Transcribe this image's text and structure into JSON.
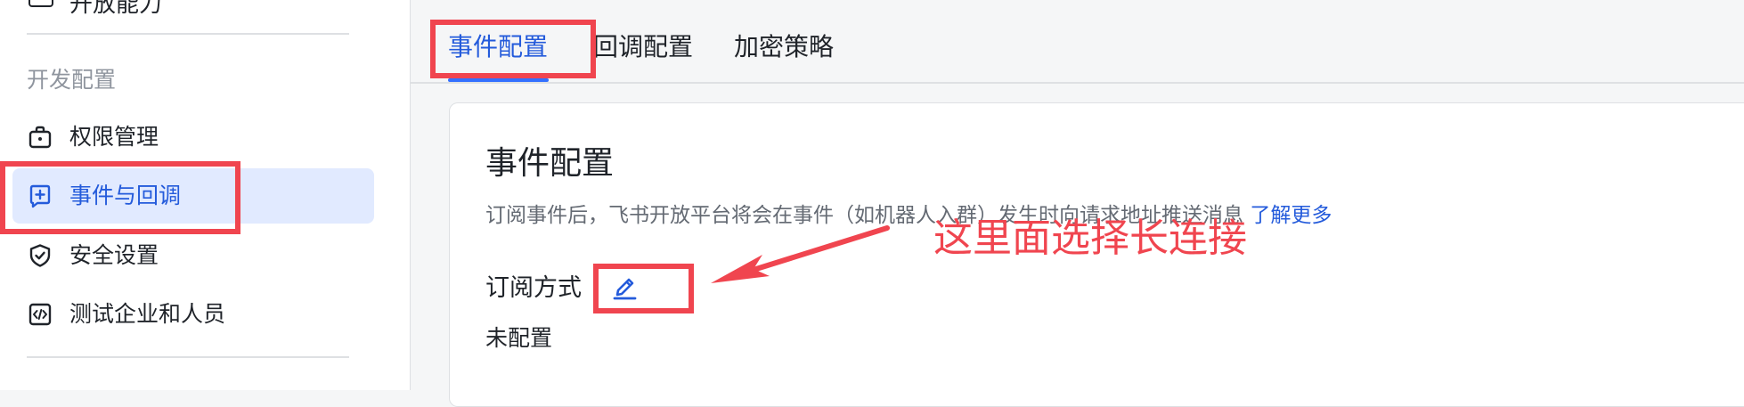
{
  "sidebar": {
    "cut_top_text": "开放能力",
    "section_title": "开发配置",
    "items": [
      {
        "label": "权限管理",
        "icon": "briefcase-icon",
        "active": false
      },
      {
        "label": "事件与回调",
        "icon": "event-plus-icon",
        "active": true
      },
      {
        "label": "安全设置",
        "icon": "shield-check-icon",
        "active": false
      },
      {
        "label": "测试企业和人员",
        "icon": "code-box-icon",
        "active": false
      }
    ]
  },
  "tabs": [
    {
      "label": "事件配置",
      "active": true
    },
    {
      "label": "回调配置",
      "active": false
    },
    {
      "label": "加密策略",
      "active": false
    }
  ],
  "card": {
    "title": "事件配置",
    "description": "订阅事件后，飞书开放平台将会在事件（如机器人入群）发生时向请求地址推送消息",
    "learn_more": "了解更多",
    "subscription_label": "订阅方式",
    "edit_icon": "pencil-icon",
    "status": "未配置"
  },
  "annotation": {
    "text": "这里面选择长连接",
    "color": "#f0454f"
  },
  "colors": {
    "accent": "#245bdb",
    "active_bg": "#e1eaff",
    "muted_text": "#8f959e",
    "annotation": "#f0454f"
  }
}
